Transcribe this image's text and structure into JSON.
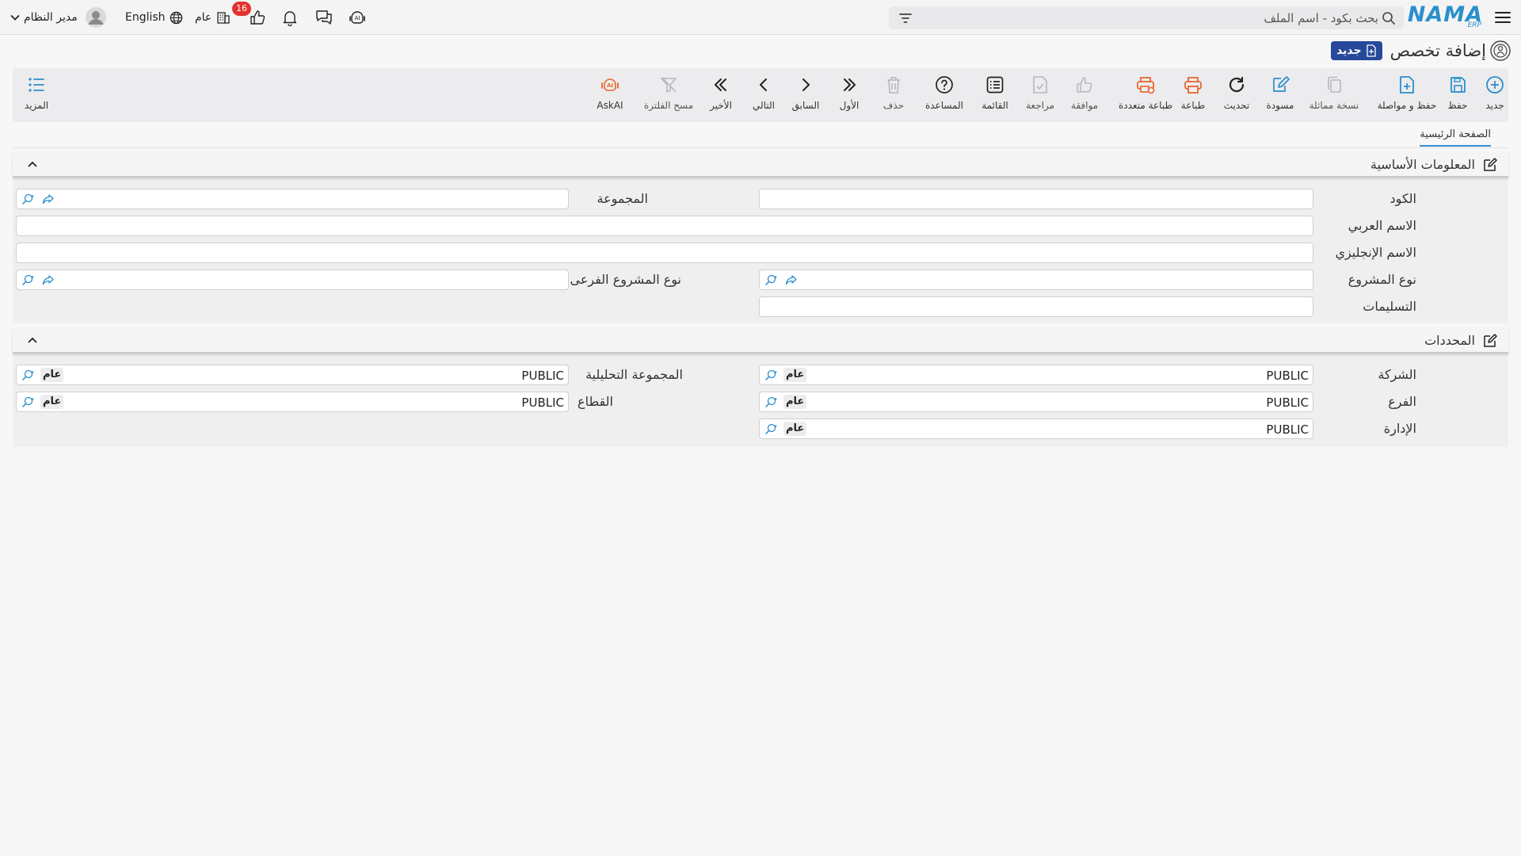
{
  "header": {
    "logo_text": "NAMA",
    "logo_sub": "ERP",
    "search_placeholder": "بحث بكود - اسم الملف",
    "notification_count": "16",
    "branch_label": "عام",
    "language_label": "English",
    "user_name": "مدير النظام"
  },
  "page": {
    "title": "إضافة تخصص",
    "new_badge": "جديد",
    "tab_main": "الصفحة الرئيسية"
  },
  "toolbar": {
    "new": "جديد",
    "save": "حفظ",
    "save_continue": "حفظ و مواصلة",
    "duplicate": "نسخة مماثلة",
    "draft": "مسودة",
    "refresh": "تحديث",
    "print": "طباعة",
    "multi_print": "طباعة متعددة",
    "approve": "موافقة",
    "review": "مراجعة",
    "list": "القائمة",
    "help": "المساعدة",
    "delete": "حذف",
    "first": "الأول",
    "previous": "السابق",
    "next": "التالي",
    "last": "الأخير",
    "clear_filter": "مسح الفلترة",
    "askai": "AskAI",
    "more": "المزيد"
  },
  "basic_info": {
    "title": "المعلومات الأساسية",
    "code_label": "الكود",
    "group_label": "المجموعة",
    "arabic_name_label": "الاسم العربي",
    "english_name_label": "الاسم الإنجليزي",
    "project_type_label": "نوع المشروع",
    "sub_project_type_label": "نوع المشروع الفرعى",
    "deliverables_label": "التسليمات",
    "code_value": "",
    "group_value": "",
    "arabic_name_value": "",
    "english_name_value": "",
    "project_type_value": "",
    "sub_project_type_value": "",
    "deliverables_value": ""
  },
  "dimensions": {
    "title": "المحددات",
    "company_label": "الشركة",
    "company_value": "PUBLIC",
    "company_chip": "عام",
    "analytic_group_label": "المجموعة التحليلية",
    "analytic_group_value": "PUBLIC",
    "analytic_group_chip": "عام",
    "branch_label": "الفرع",
    "branch_value": "PUBLIC",
    "branch_chip": "عام",
    "sector_label": "القطاع",
    "sector_value": "PUBLIC",
    "sector_chip": "عام",
    "department_label": "الإدارة",
    "department_value": "PUBLIC",
    "department_chip": "عام"
  },
  "colors": {
    "accent_blue": "#2b8fcc",
    "badge_blue": "#26499a",
    "print_orange": "#e8642c",
    "notification_red": "#e2332f"
  }
}
